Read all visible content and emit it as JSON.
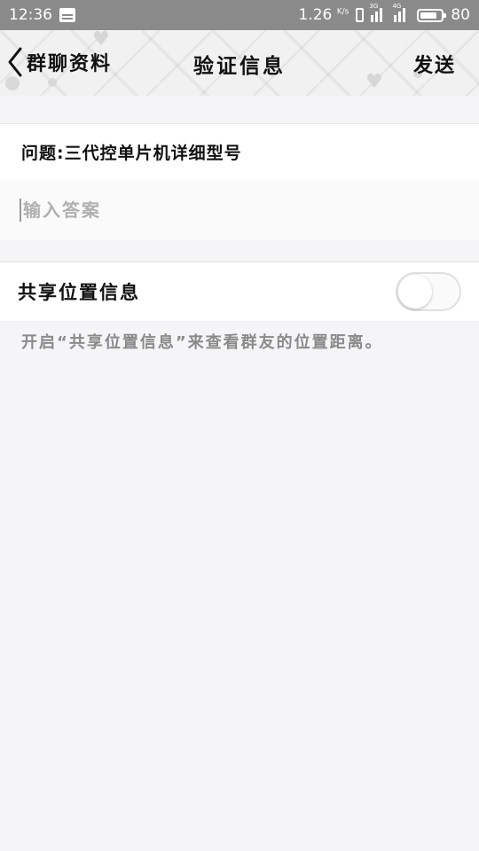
{
  "status_bar": {
    "time": "12:36",
    "network_speed": "1.26",
    "network_speed_unit": "K/s",
    "signal_1_tag": "3G",
    "signal_2_tag": "4G",
    "battery": "80",
    "icons": [
      "news-icon",
      "vibrate-icon",
      "signal-icon",
      "signal-icon",
      "battery-icon"
    ]
  },
  "header": {
    "back_label": "群聊资料",
    "title": "验证信息",
    "send_label": "发送"
  },
  "question": {
    "text": "问题:三代控单片机详细型号"
  },
  "answer": {
    "value": "",
    "placeholder": "输入答案"
  },
  "share_location": {
    "label": "共享位置信息",
    "enabled": false,
    "hint": "开启“共享位置信息”来查看群友的位置距离。"
  },
  "colors": {
    "status_bar": "#8a8a8a",
    "page_background": "#f5f5f7",
    "hint_text": "#8a8a8a"
  }
}
